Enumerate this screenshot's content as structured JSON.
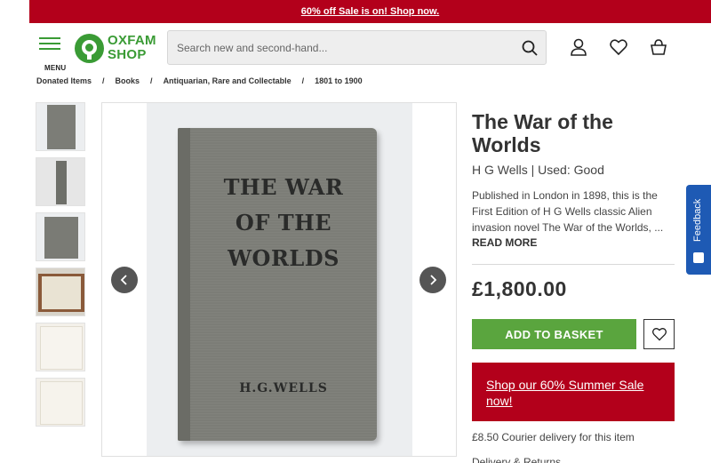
{
  "promo": {
    "text": "60% off Sale is on! Shop now."
  },
  "header": {
    "menu_label": "MENU",
    "logo_line1": "OXFAM",
    "logo_line2": "SHOP",
    "search_placeholder": "Search new and second-hand..."
  },
  "breadcrumb": [
    "Donated Items",
    "Books",
    "Antiquarian, Rare and Collectable",
    "1801 to 1900"
  ],
  "gallery": {
    "cover_title_line1": "THE WAR",
    "cover_title_line2": "OF THE WORLDS",
    "cover_author": "H.G.WELLS"
  },
  "product": {
    "title": "The War of the Worlds",
    "subtitle": "H G Wells | Used: Good",
    "description": "Published in London in 1898, this is the First Edition of H G Wells classic Alien invasion novel The War of the Worlds, ...",
    "read_more": "READ MORE",
    "price": "£1,800.00",
    "add_to_basket": "ADD TO BASKET",
    "sale_banner": "Shop our 60% Summer Sale now!",
    "delivery": "£8.50 Courier delivery for this item",
    "returns": "Delivery & Returns"
  },
  "feedback": {
    "label": "Feedback"
  },
  "colors": {
    "brand_red": "#b3001b",
    "brand_green": "#3a9b35",
    "button_green": "#5aa53e",
    "feedback_blue": "#1e5ab4"
  }
}
